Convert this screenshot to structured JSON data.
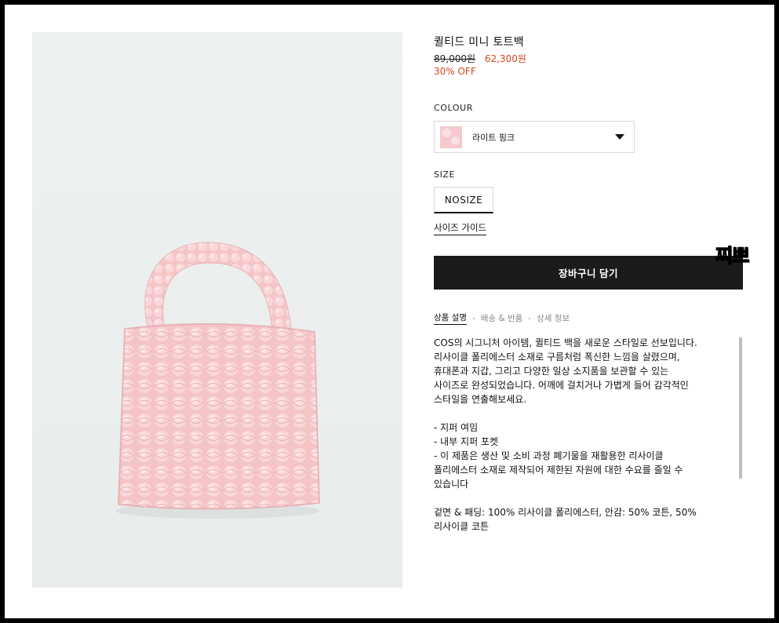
{
  "product": {
    "title": "퀼티드 미니 토트백",
    "price_original": "89,000원",
    "price_sale": "62,300원",
    "discount": "30% OFF"
  },
  "colour": {
    "label": "COLOUR",
    "selected": "라이트 핑크"
  },
  "size": {
    "label": "SIZE",
    "selected": "NOSIZE",
    "guide_link": "사이즈 가이드"
  },
  "cart_button": "장바구니 담기",
  "tabs": [
    {
      "label": "상품 설명",
      "active": true
    },
    {
      "label": "배송 & 반품",
      "active": false
    },
    {
      "label": "상세 정보",
      "active": false
    }
  ],
  "tab_separator": "-",
  "description": {
    "lines_1": [
      "COS의 시그니처 아이템, 퀼티드 백을 새로운 스타일로 선보입니다.",
      "리사이클 폴리에스터 소재로 구름처럼 폭신한 느낌을 살렸으며,",
      "휴대폰과 지갑, 그리고 다양한 일상 소지품을 보관할 수 있는",
      "사이즈로 완성되었습니다. 어깨에 걸치거나 가볍게 들어 감각적인",
      "스타일을 연출해보세요."
    ],
    "lines_2": [
      "- 지퍼 여밈",
      "- 내부 지퍼 포켓",
      "- 이 제품은 생산 및 소비 과정 폐기물을 재활용한 리사이클",
      "폴리에스터 소재로 제작되어 제한된 자원에 대한 수요를 줄일 수",
      "있습니다"
    ],
    "lines_3": [
      "겉면 & 패딩: 100% 리사이클 폴리에스터, 안감: 50% 코튼, 50%",
      "리사이클 코튼"
    ]
  },
  "sticker_text": "찌쁘",
  "colors": {
    "sale": "#d4451c",
    "button_bg": "#1b1b1b",
    "bag_pink": "#f6c9cc",
    "sticker": "#ecf44b"
  }
}
